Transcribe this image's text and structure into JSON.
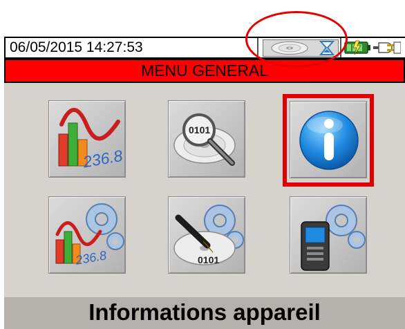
{
  "status_bar": {
    "datetime": "06/05/2015 14:27:53",
    "icons": [
      "cd-disc-icon",
      "hourglass-icon",
      "battery-icon",
      "power-plug-icon"
    ]
  },
  "title_bar": {
    "title": "MENU GENERAL",
    "color": "#ff0000"
  },
  "menu": {
    "items": [
      {
        "icon": "realtime-measurements-icon",
        "label": "236.8"
      },
      {
        "icon": "recorded-data-browse-icon",
        "label": "0101"
      },
      {
        "icon": "device-information-icon",
        "selected": true
      },
      {
        "icon": "analyzer-settings-icon",
        "label": "236.8"
      },
      {
        "icon": "recording-settings-icon",
        "label": "0101"
      },
      {
        "icon": "instrument-settings-icon"
      }
    ]
  },
  "footer": {
    "selected_label": "Informations appareil"
  },
  "colors": {
    "accent_red": "#e00000",
    "panel_bg": "#d6d2ce",
    "footer_bg": "#b4b0ac"
  }
}
